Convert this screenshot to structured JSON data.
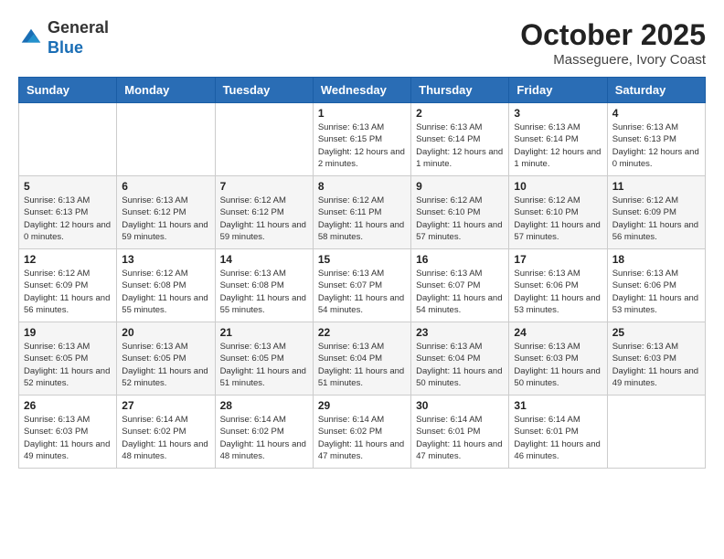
{
  "header": {
    "logo_general": "General",
    "logo_blue": "Blue",
    "month": "October 2025",
    "location": "Masseguere, Ivory Coast"
  },
  "weekdays": [
    "Sunday",
    "Monday",
    "Tuesday",
    "Wednesday",
    "Thursday",
    "Friday",
    "Saturday"
  ],
  "weeks": [
    [
      {
        "day": "",
        "info": ""
      },
      {
        "day": "",
        "info": ""
      },
      {
        "day": "",
        "info": ""
      },
      {
        "day": "1",
        "info": "Sunrise: 6:13 AM\nSunset: 6:15 PM\nDaylight: 12 hours and 2 minutes."
      },
      {
        "day": "2",
        "info": "Sunrise: 6:13 AM\nSunset: 6:14 PM\nDaylight: 12 hours and 1 minute."
      },
      {
        "day": "3",
        "info": "Sunrise: 6:13 AM\nSunset: 6:14 PM\nDaylight: 12 hours and 1 minute."
      },
      {
        "day": "4",
        "info": "Sunrise: 6:13 AM\nSunset: 6:13 PM\nDaylight: 12 hours and 0 minutes."
      }
    ],
    [
      {
        "day": "5",
        "info": "Sunrise: 6:13 AM\nSunset: 6:13 PM\nDaylight: 12 hours and 0 minutes."
      },
      {
        "day": "6",
        "info": "Sunrise: 6:13 AM\nSunset: 6:12 PM\nDaylight: 11 hours and 59 minutes."
      },
      {
        "day": "7",
        "info": "Sunrise: 6:12 AM\nSunset: 6:12 PM\nDaylight: 11 hours and 59 minutes."
      },
      {
        "day": "8",
        "info": "Sunrise: 6:12 AM\nSunset: 6:11 PM\nDaylight: 11 hours and 58 minutes."
      },
      {
        "day": "9",
        "info": "Sunrise: 6:12 AM\nSunset: 6:10 PM\nDaylight: 11 hours and 57 minutes."
      },
      {
        "day": "10",
        "info": "Sunrise: 6:12 AM\nSunset: 6:10 PM\nDaylight: 11 hours and 57 minutes."
      },
      {
        "day": "11",
        "info": "Sunrise: 6:12 AM\nSunset: 6:09 PM\nDaylight: 11 hours and 56 minutes."
      }
    ],
    [
      {
        "day": "12",
        "info": "Sunrise: 6:12 AM\nSunset: 6:09 PM\nDaylight: 11 hours and 56 minutes."
      },
      {
        "day": "13",
        "info": "Sunrise: 6:12 AM\nSunset: 6:08 PM\nDaylight: 11 hours and 55 minutes."
      },
      {
        "day": "14",
        "info": "Sunrise: 6:13 AM\nSunset: 6:08 PM\nDaylight: 11 hours and 55 minutes."
      },
      {
        "day": "15",
        "info": "Sunrise: 6:13 AM\nSunset: 6:07 PM\nDaylight: 11 hours and 54 minutes."
      },
      {
        "day": "16",
        "info": "Sunrise: 6:13 AM\nSunset: 6:07 PM\nDaylight: 11 hours and 54 minutes."
      },
      {
        "day": "17",
        "info": "Sunrise: 6:13 AM\nSunset: 6:06 PM\nDaylight: 11 hours and 53 minutes."
      },
      {
        "day": "18",
        "info": "Sunrise: 6:13 AM\nSunset: 6:06 PM\nDaylight: 11 hours and 53 minutes."
      }
    ],
    [
      {
        "day": "19",
        "info": "Sunrise: 6:13 AM\nSunset: 6:05 PM\nDaylight: 11 hours and 52 minutes."
      },
      {
        "day": "20",
        "info": "Sunrise: 6:13 AM\nSunset: 6:05 PM\nDaylight: 11 hours and 52 minutes."
      },
      {
        "day": "21",
        "info": "Sunrise: 6:13 AM\nSunset: 6:05 PM\nDaylight: 11 hours and 51 minutes."
      },
      {
        "day": "22",
        "info": "Sunrise: 6:13 AM\nSunset: 6:04 PM\nDaylight: 11 hours and 51 minutes."
      },
      {
        "day": "23",
        "info": "Sunrise: 6:13 AM\nSunset: 6:04 PM\nDaylight: 11 hours and 50 minutes."
      },
      {
        "day": "24",
        "info": "Sunrise: 6:13 AM\nSunset: 6:03 PM\nDaylight: 11 hours and 50 minutes."
      },
      {
        "day": "25",
        "info": "Sunrise: 6:13 AM\nSunset: 6:03 PM\nDaylight: 11 hours and 49 minutes."
      }
    ],
    [
      {
        "day": "26",
        "info": "Sunrise: 6:13 AM\nSunset: 6:03 PM\nDaylight: 11 hours and 49 minutes."
      },
      {
        "day": "27",
        "info": "Sunrise: 6:14 AM\nSunset: 6:02 PM\nDaylight: 11 hours and 48 minutes."
      },
      {
        "day": "28",
        "info": "Sunrise: 6:14 AM\nSunset: 6:02 PM\nDaylight: 11 hours and 48 minutes."
      },
      {
        "day": "29",
        "info": "Sunrise: 6:14 AM\nSunset: 6:02 PM\nDaylight: 11 hours and 47 minutes."
      },
      {
        "day": "30",
        "info": "Sunrise: 6:14 AM\nSunset: 6:01 PM\nDaylight: 11 hours and 47 minutes."
      },
      {
        "day": "31",
        "info": "Sunrise: 6:14 AM\nSunset: 6:01 PM\nDaylight: 11 hours and 46 minutes."
      },
      {
        "day": "",
        "info": ""
      }
    ]
  ]
}
